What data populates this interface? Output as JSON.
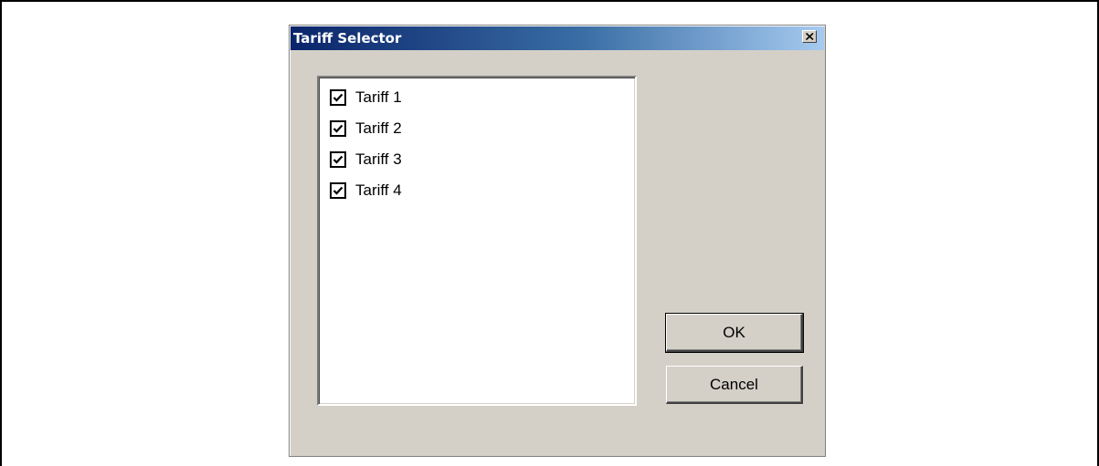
{
  "window": {
    "title": "Tariff Selector",
    "close_icon": "close-icon"
  },
  "tariff_list": {
    "items": [
      {
        "label": "Tariff 1",
        "checked": true
      },
      {
        "label": "Tariff 2",
        "checked": true
      },
      {
        "label": "Tariff 3",
        "checked": true
      },
      {
        "label": "Tariff 4",
        "checked": true
      }
    ]
  },
  "buttons": {
    "ok_label": "OK",
    "cancel_label": "Cancel"
  },
  "colors": {
    "title_gradient_start": "#0a246a",
    "title_gradient_end": "#a6caf0",
    "dialog_face": "#d4d0c8"
  }
}
